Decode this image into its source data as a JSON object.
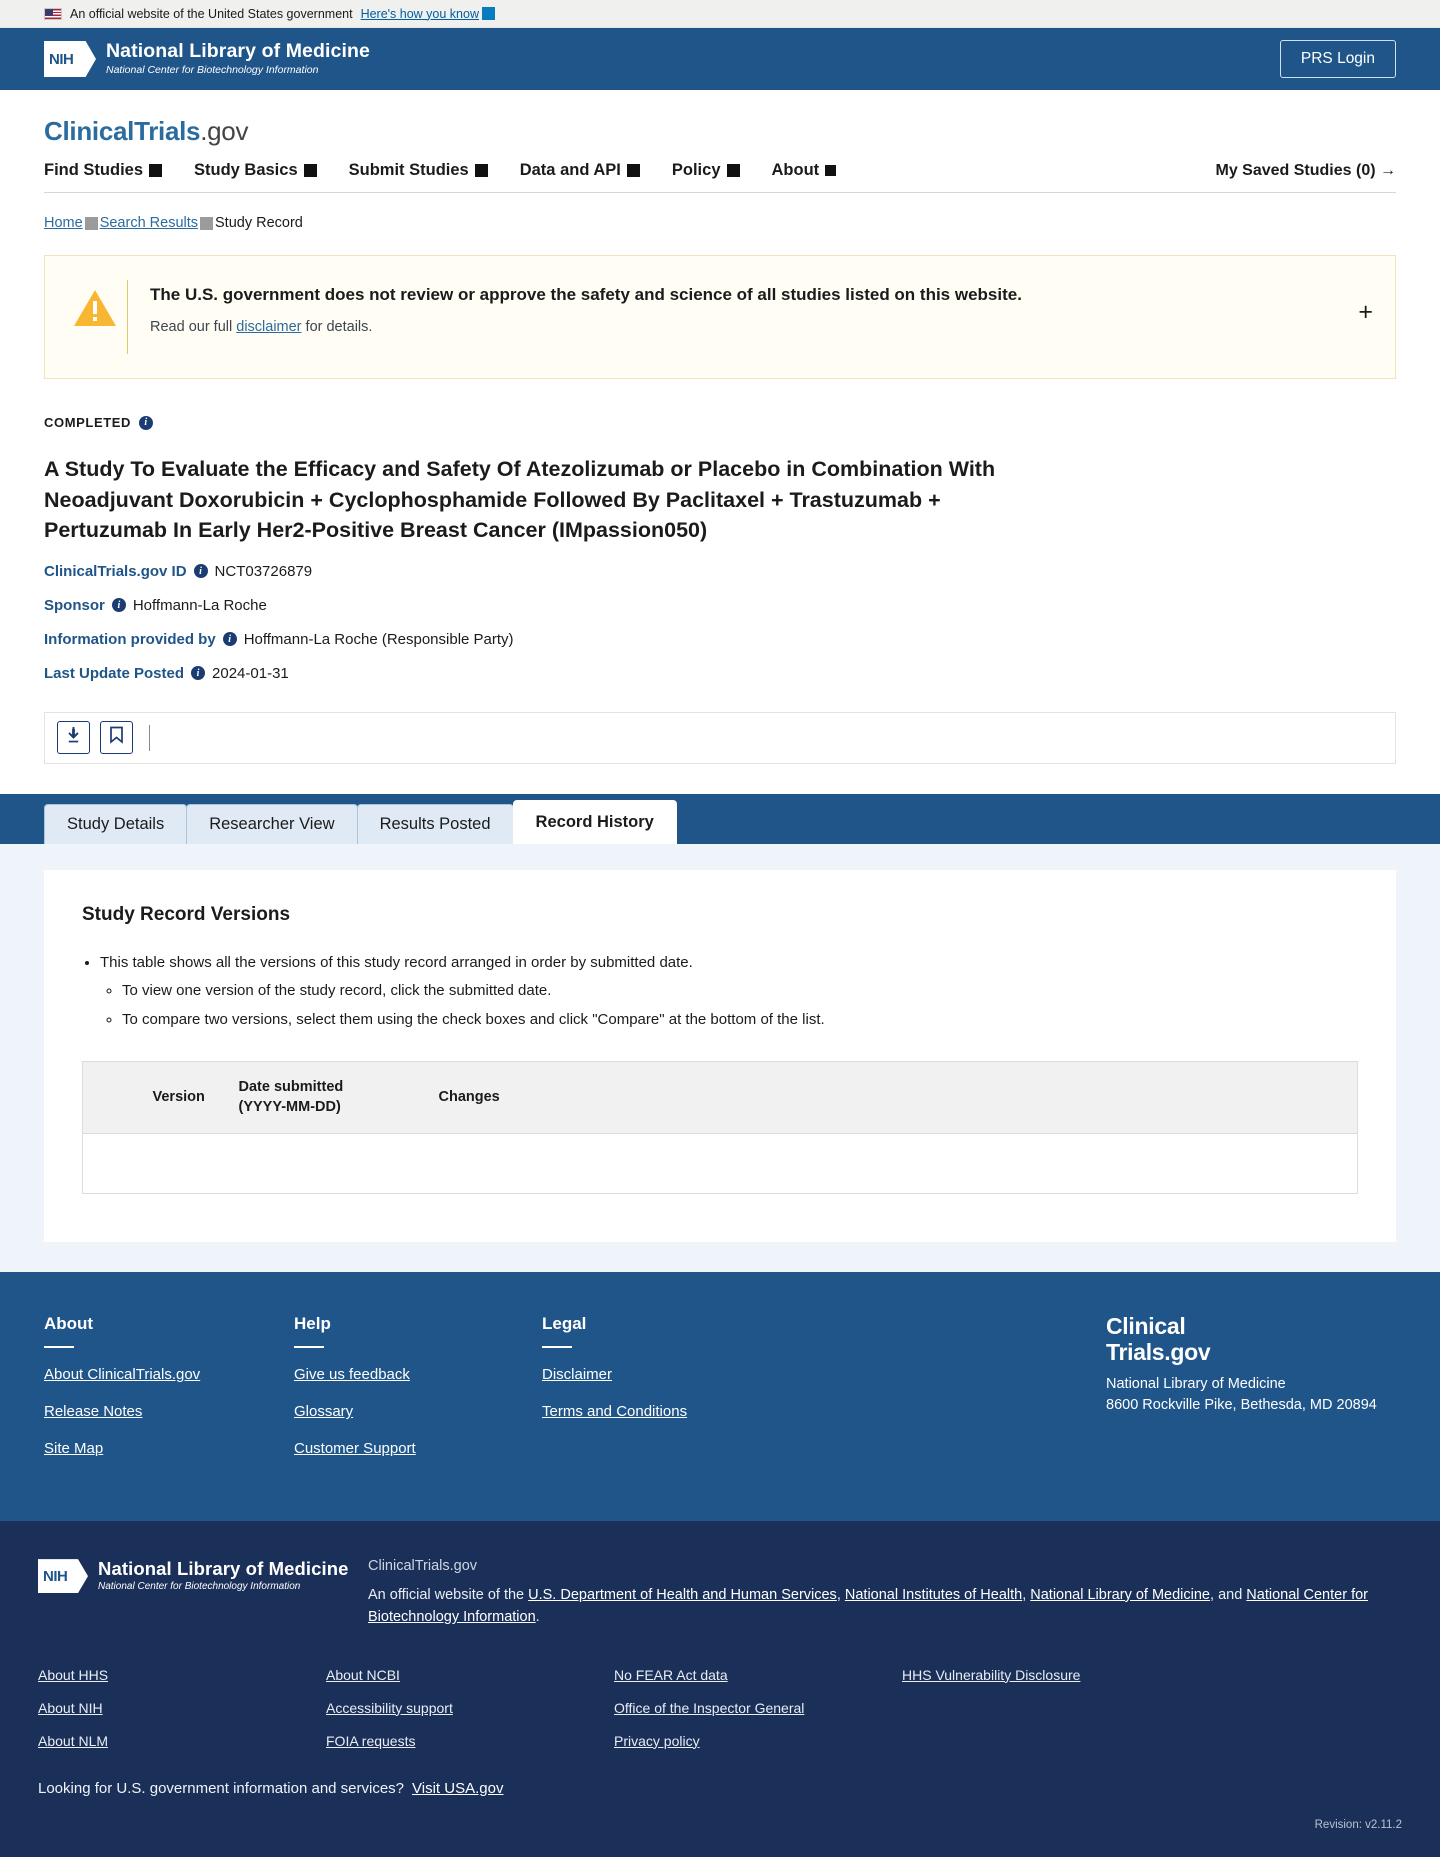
{
  "usa_banner": {
    "text": "An official website of the United States government",
    "link": "Here's how you know",
    "flag_icon": "us-flag-icon"
  },
  "nlm_bar": {
    "logo_mark": "NIH",
    "line1": "National Library of Medicine",
    "line2": "National Center for Biotechnology Information",
    "prs_login": "PRS Login"
  },
  "site_header": {
    "brand_primary": "ClinicalTrials",
    "brand_secondary": ".gov",
    "nav": [
      {
        "label": "Find Studies"
      },
      {
        "label": "Study Basics"
      },
      {
        "label": "Submit Studies"
      },
      {
        "label": "Data and API"
      },
      {
        "label": "Policy"
      },
      {
        "label": "About"
      }
    ],
    "saved_studies": "My Saved Studies (0) →"
  },
  "breadcrumb": {
    "home": "Home",
    "search_results": "Search Results",
    "current": "Study Record"
  },
  "alert": {
    "icon": "warning-triangle-icon",
    "title": "The U.S. government does not review or approve the safety and science of all studies listed on this website.",
    "sub_before": "Read our full ",
    "sub_link": "disclaimer",
    "sub_after": " for details.",
    "expand": "+"
  },
  "study": {
    "status": "COMPLETED",
    "title": "A Study To Evaluate the Efficacy and Safety Of Atezolizumab or Placebo in Combination With Neoadjuvant Doxorubicin + Cyclophosphamide Followed By Paclitaxel + Trastuzumab + Pertuzumab In Early Her2-Positive Breast Cancer (IMpassion050)",
    "meta": [
      {
        "label": "ClinicalTrials.gov ID",
        "value": "NCT03726879"
      },
      {
        "label": "Sponsor",
        "value": "Hoffmann-La Roche"
      },
      {
        "label": "Information provided by",
        "value": "Hoffmann-La Roche (Responsible Party)"
      },
      {
        "label": "Last Update Posted",
        "value": "2024-01-31"
      }
    ]
  },
  "toolbar": {
    "download_icon": "download-icon",
    "save_icon": "bookmark-icon"
  },
  "tabs": [
    {
      "label": "Study Details",
      "active": false
    },
    {
      "label": "Researcher View",
      "active": false
    },
    {
      "label": "Results Posted",
      "active": false
    },
    {
      "label": "Record History",
      "active": true
    }
  ],
  "record_history": {
    "heading": "Study Record Versions",
    "bullet_main": "This table shows all the versions of this study record arranged in order by submitted date.",
    "bullet_sub_1": "To view one version of the study record, click the submitted date.",
    "bullet_sub_2": "To compare two versions, select them using the check boxes and click \"Compare\" at the bottom of the list.",
    "table": {
      "headers": {
        "select": "",
        "version": "Version",
        "date_line1": "Date submitted",
        "date_line2": "(YYYY-MM-DD)",
        "changes": "Changes"
      },
      "rows": []
    }
  },
  "footer": {
    "columns": [
      {
        "heading": "About",
        "links": [
          "About ClinicalTrials.gov",
          "Release Notes",
          "Site Map"
        ]
      },
      {
        "heading": "Help",
        "links": [
          "Give us feedback",
          "Glossary",
          "Customer Support"
        ]
      },
      {
        "heading": "Legal",
        "links": [
          "Disclaimer",
          "Terms and Conditions"
        ]
      }
    ],
    "brand": {
      "line1": "Clinical",
      "line2": "Trials.gov",
      "org": "National Library of Medicine",
      "address": "8600 Rockville Pike, Bethesda, MD 20894"
    }
  },
  "footer_dark": {
    "logo_mark": "NIH",
    "logo_line1": "National Library of Medicine",
    "logo_line2": "National Center for Biotechnology Information",
    "site_name": "ClinicalTrials.gov",
    "official_prefix": "An official website of the ",
    "official_links": [
      "U.S. Department of Health and Human Services",
      "National Institutes of Health",
      "National Library of Medicine",
      "National Center for Biotechnology Information"
    ],
    "official_and": "and ",
    "link_columns": [
      [
        "About HHS",
        "About NIH",
        "About NLM"
      ],
      [
        "About NCBI",
        "Accessibility support",
        "FOIA requests"
      ],
      [
        "No FEAR Act data",
        "Office of the Inspector General",
        "Privacy policy"
      ],
      [
        "HHS Vulnerability Disclosure"
      ]
    ],
    "usa_text": "Looking for U.S. government information and services?",
    "usa_link": "Visit USA.gov",
    "revision": "Revision: v2.11.2"
  },
  "colors": {
    "nlm_blue": "#20558a",
    "dark_footer": "#1b3058",
    "link_blue": "#2a6ca0",
    "alert_bg": "#fffdf4",
    "alert_icon": "#f5ad1e",
    "panel_bg": "#eef4fa"
  }
}
